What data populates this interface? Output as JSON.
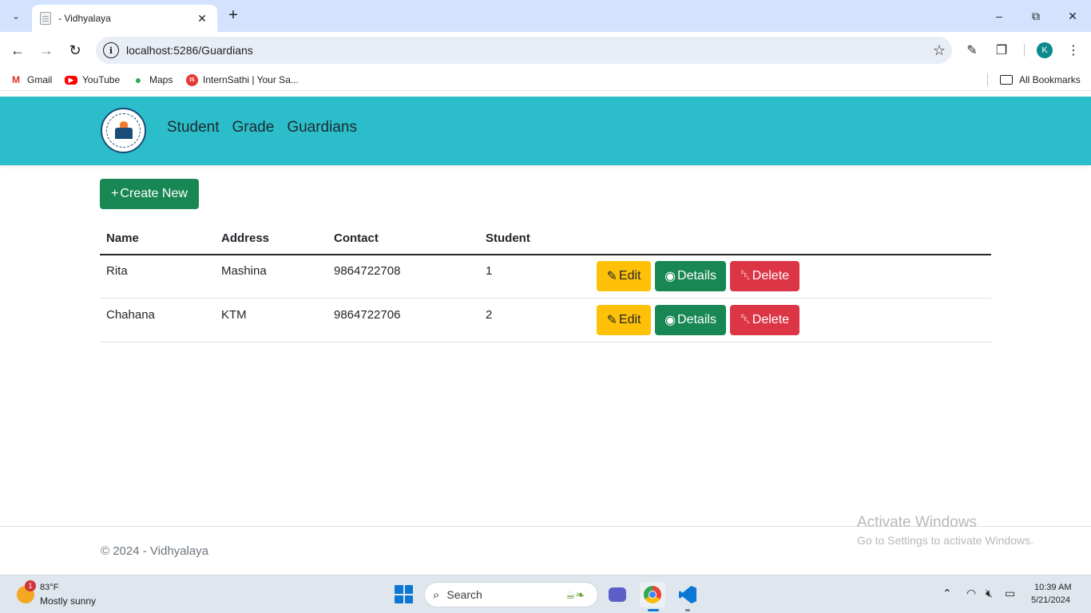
{
  "browser": {
    "tab_title": "- Vidhyalaya",
    "url": "localhost:5286/Guardians",
    "profile_initial": "K",
    "bookmarks": [
      {
        "label": "Gmail",
        "icon": "gmail-icon"
      },
      {
        "label": "YouTube",
        "icon": "youtube-icon"
      },
      {
        "label": "Maps",
        "icon": "maps-icon"
      },
      {
        "label": "InternSathi | Your Sa...",
        "icon": "internsathi-icon"
      }
    ],
    "all_bookmarks": "All Bookmarks"
  },
  "site": {
    "nav": [
      "Student",
      "Grade",
      "Guardians"
    ],
    "create_label": "Create New",
    "table": {
      "headers": [
        "Name",
        "Address",
        "Contact",
        "Student"
      ],
      "rows": [
        {
          "name": "Rita",
          "address": "Mashina",
          "contact": "9864722708",
          "student": "1"
        },
        {
          "name": "Chahana",
          "address": "KTM",
          "contact": "9864722706",
          "student": "2"
        }
      ],
      "actions": {
        "edit": "Edit",
        "details": "Details",
        "delete": "Delete"
      }
    },
    "footer": "© 2024 - Vidhyalaya",
    "colors": {
      "navbar": "#2bbdca",
      "success": "#198754",
      "warning": "#ffc107",
      "danger": "#dc3545"
    }
  },
  "watermark": {
    "line1": "Activate Windows",
    "line2": "Go to Settings to activate Windows."
  },
  "taskbar": {
    "weather_badge": "1",
    "temperature": "83°F",
    "weather": "Mostly sunny",
    "search_placeholder": "Search",
    "time": "10:39 AM",
    "date": "5/21/2024"
  }
}
